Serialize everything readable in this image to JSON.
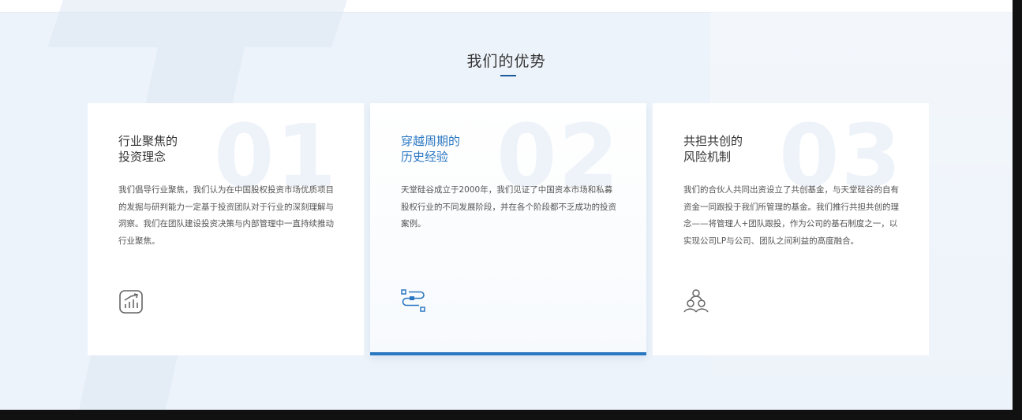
{
  "section": {
    "title": "我们的优势"
  },
  "cards": [
    {
      "number": "01",
      "title_line1": "行业聚焦的",
      "title_line2": "投资理念",
      "description": "我们倡导行业聚焦，我们认为在中国股权投资市场优质项目的发掘与研判能力一定基于投资团队对于行业的深刻理解与洞察。我们在团队建设投资决策与内部管理中一直持续推动行业聚焦。",
      "icon": "growth-chart-icon",
      "active": false
    },
    {
      "number": "02",
      "title_line1": "穿越周期的",
      "title_line2": "历史经验",
      "description": "天堂硅谷成立于2000年，我们见证了中国资本市场和私募股权行业的不同发展阶段，并在各个阶段都不乏成功的投资案例。",
      "icon": "process-flow-icon",
      "active": true
    },
    {
      "number": "03",
      "title_line1": "共担共创的",
      "title_line2": "风险机制",
      "description": "我们的合伙人共同出资设立了共创基金，与天堂硅谷的自有资金一同跟投于我们所管理的基金。我们推行共担共创的理念——将管理人+团队跟投，作为公司的基石制度之一，以实现公司LP与公司、团队之间利益的高度融合。",
      "icon": "team-people-icon",
      "active": false
    }
  ],
  "colors": {
    "accent": "#2a77c2",
    "title_underline": "#1c5b9a",
    "background": "#edf3fa",
    "icon_gray": "#666666"
  }
}
